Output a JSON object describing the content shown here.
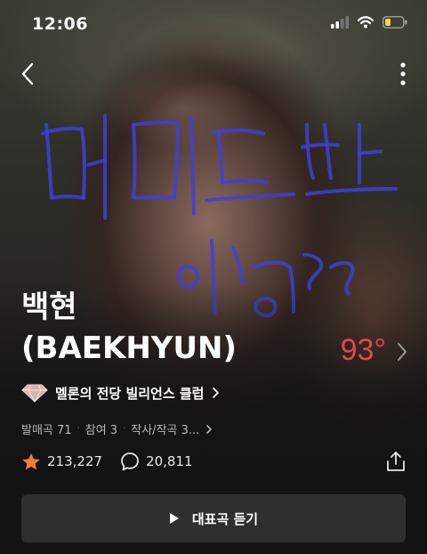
{
  "status_bar": {
    "time": "12:06"
  },
  "artist": {
    "name_korean": "백현",
    "name_english": "(BAEKHYUN)"
  },
  "temperature": "93°",
  "hall_of_fame": {
    "label": "멜론의 전당 빌리언스 클럽"
  },
  "meta": {
    "releases": "발매곡 71",
    "participation": "참여 3",
    "credits": "작사/작곡 3..."
  },
  "stats": {
    "likes": "213,227",
    "comments": "20,811"
  },
  "play_button": {
    "label": "대표곡 듣기"
  },
  "colors": {
    "accent_temperature": "#e5454c",
    "star": "#ef7d3c",
    "scribble_ink": "#3b3bd6"
  }
}
